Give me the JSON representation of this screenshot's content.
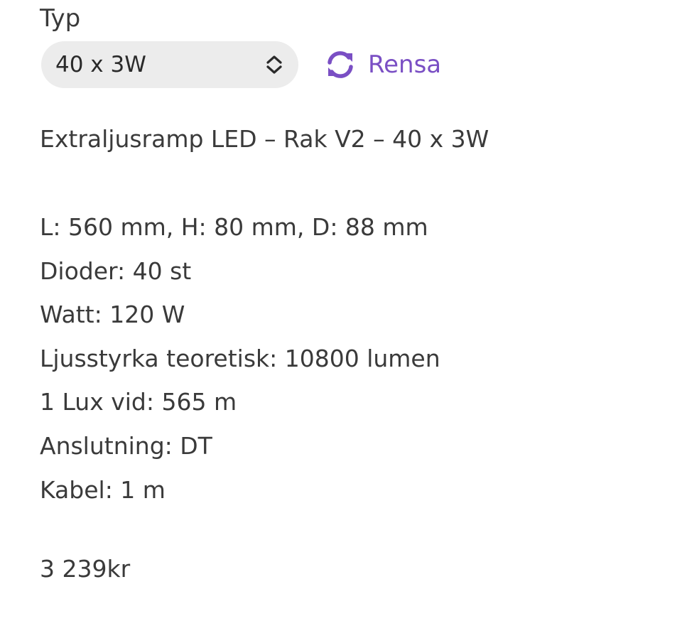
{
  "variation": {
    "label": "Typ",
    "selected": "40 x 3W",
    "reset_label": "Rensa"
  },
  "product": {
    "name": "Extraljusramp LED – Rak V2 – 40 x 3W",
    "specs": [
      "L: 560 mm, H: 80 mm, D: 88 mm",
      "Dioder: 40 st",
      "Watt: 120 W",
      "Ljusstyrka teoretisk: 10800 lumen",
      "1 Lux vid: 565 m",
      "Anslutning: DT",
      "Kabel: 1 m"
    ],
    "price": "3 239kr"
  },
  "icons": {
    "select": "chevron-up-down-icon",
    "reset": "refresh-icon"
  },
  "colors": {
    "accent": "#7a4fc4",
    "select_bg": "#ececec",
    "text": "#3a3a3a"
  }
}
